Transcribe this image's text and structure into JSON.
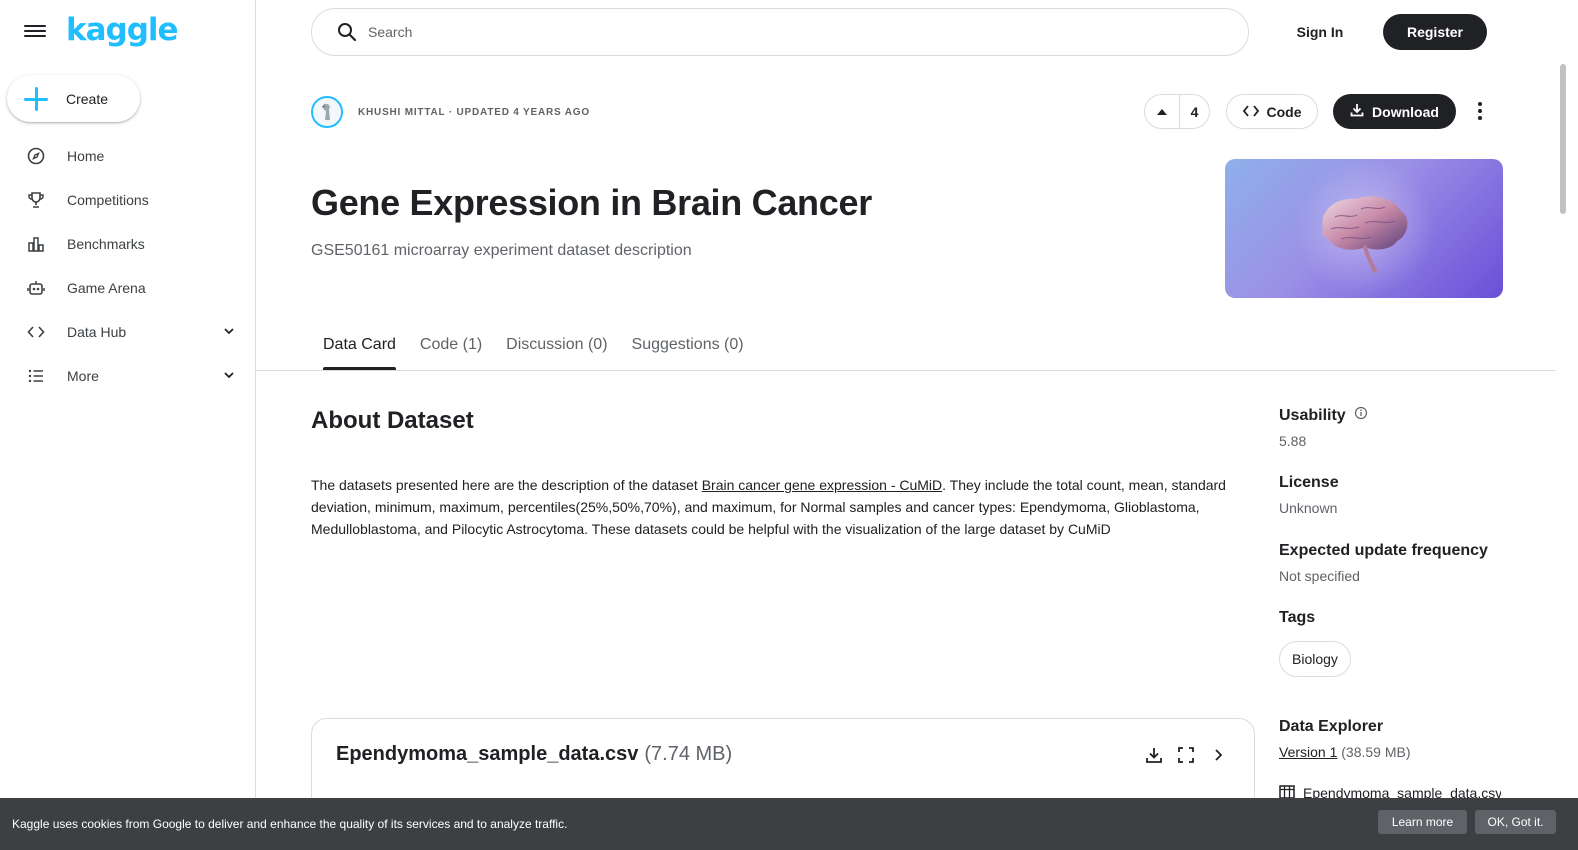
{
  "app": {
    "logo": "kaggle"
  },
  "sidebar": {
    "create_label": "Create",
    "items": [
      {
        "label": "Home",
        "icon": "compass-icon"
      },
      {
        "label": "Competitions",
        "icon": "trophy-icon"
      },
      {
        "label": "Benchmarks",
        "icon": "bar-chart-icon"
      },
      {
        "label": "Game Arena",
        "icon": "robot-icon"
      },
      {
        "label": "Data Hub",
        "icon": "code-icon"
      },
      {
        "label": "More",
        "icon": "list-icon"
      }
    ]
  },
  "header": {
    "search_placeholder": "Search",
    "signin_label": "Sign In",
    "register_label": "Register"
  },
  "dataset": {
    "owner_line": "KHUSHI MITTAL · UPDATED 4 YEARS AGO",
    "vote_count": "4",
    "code_label": "Code",
    "download_label": "Download",
    "title": "Gene Expression in Brain Cancer",
    "subtitle": "GSE50161 microarray experiment dataset description"
  },
  "tabs": [
    {
      "label": "Data Card",
      "active": true
    },
    {
      "label": "Code (1)",
      "active": false
    },
    {
      "label": "Discussion (0)",
      "active": false
    },
    {
      "label": "Suggestions (0)",
      "active": false
    }
  ],
  "about": {
    "title": "About Dataset",
    "text_before_link": "The datasets presented here are the description of the dataset ",
    "link_text": "Brain cancer gene expression - CuMiD",
    "text_after_link": ". They include the total count, mean, standard deviation, minimum, maximum, percentiles(25%,50%,70%), and maximum, for Normal samples and cancer types: Ependymoma, Glioblastoma, Medulloblastoma, and Pilocytic Astrocytoma. These datasets could be helpful with the visualization of the large dataset by CuMiD"
  },
  "file": {
    "name": "Ependymoma_sample_data.csv",
    "size": "(7.74 MB)"
  },
  "rail": {
    "usability_label": "Usability",
    "usability_value": "5.88",
    "license_label": "License",
    "license_value": "Unknown",
    "update_label": "Expected update frequency",
    "update_value": "Not specified",
    "tags_label": "Tags",
    "tag": "Biology",
    "explorer_label": "Data Explorer",
    "version_link": "Version 1",
    "version_size": "(38.59 MB)",
    "explorer_file": "Ependymoma_sample_data.csv"
  },
  "cookie": {
    "text": "Kaggle uses cookies from Google to deliver and enhance the quality of its services and to analyze traffic.",
    "learn_more": "Learn more",
    "ok": "OK, Got it."
  },
  "colors": {
    "brand": "#20beff",
    "dark": "#202124",
    "muted": "#5f6368"
  }
}
